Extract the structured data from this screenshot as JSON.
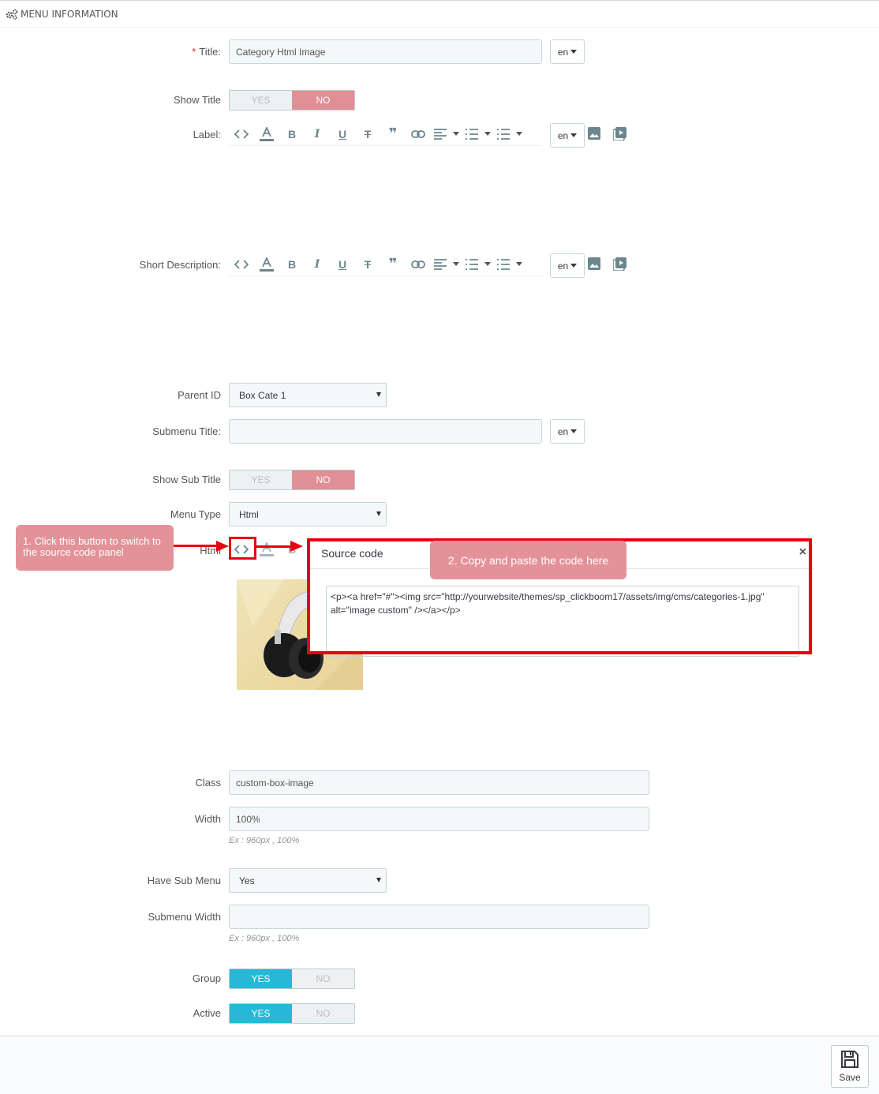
{
  "panel": {
    "title": "MENU INFORMATION",
    "icon": "cogs-icon"
  },
  "form": {
    "title": {
      "required_mark": "*",
      "label": "Title:",
      "value": "Category Html Image",
      "lang": "en"
    },
    "show_title": {
      "label": "Show Title",
      "yes": "YES",
      "no": "NO",
      "selected": "NO"
    },
    "label": {
      "label": "Label:",
      "lang": "en"
    },
    "short_description": {
      "label": "Short Description:",
      "lang": "en"
    },
    "parent_id": {
      "label": "Parent ID",
      "value": "Box Cate 1"
    },
    "submenu_title": {
      "label": "Submenu Title:",
      "value": "",
      "lang": "en"
    },
    "show_sub_title": {
      "label": "Show Sub Title",
      "yes": "YES",
      "no": "NO",
      "selected": "NO"
    },
    "menu_type": {
      "label": "Menu Type",
      "value": "Html"
    },
    "html": {
      "label": "Html"
    },
    "class": {
      "label": "Class",
      "value": "custom-box-image"
    },
    "width": {
      "label": "Width",
      "value": "100%",
      "help": "Ex : 960px , 100%"
    },
    "have_sub_menu": {
      "label": "Have Sub Menu",
      "value": "Yes"
    },
    "submenu_width": {
      "label": "Submenu Width",
      "value": "",
      "help": "Ex : 960px , 100%"
    },
    "group": {
      "label": "Group",
      "yes": "YES",
      "no": "NO",
      "selected": "YES"
    },
    "active": {
      "label": "Active",
      "yes": "YES",
      "no": "NO",
      "selected": "YES"
    }
  },
  "editor_toolbar": [
    "code-view-icon",
    "font-color-icon",
    "bold-icon",
    "italic-icon",
    "underline-icon",
    "strikethrough-icon",
    "blockquote-icon",
    "link-icon",
    "align-icon",
    "bullet-list-icon",
    "numbered-list-icon",
    "image-icon",
    "video-icon"
  ],
  "callouts": {
    "step1": "1. Click this button to switch to the source code panel",
    "step2": "2. Copy and paste the code here"
  },
  "source_code_modal": {
    "title": "Source code",
    "close": "×",
    "code_line1": "<p><a href=\"#\"><img src=\"http://yourwebsite/themes/sp_clickboom17/assets/img/cms/categories-1.jpg\"",
    "code_line2": "alt=\"image custom\" /></a></p>"
  },
  "footer": {
    "save_label": "Save"
  },
  "colors": {
    "accent": "#25b9d7",
    "no_active": "#e08f95",
    "callout": "#e39299",
    "annotation_red": "#e60012"
  }
}
